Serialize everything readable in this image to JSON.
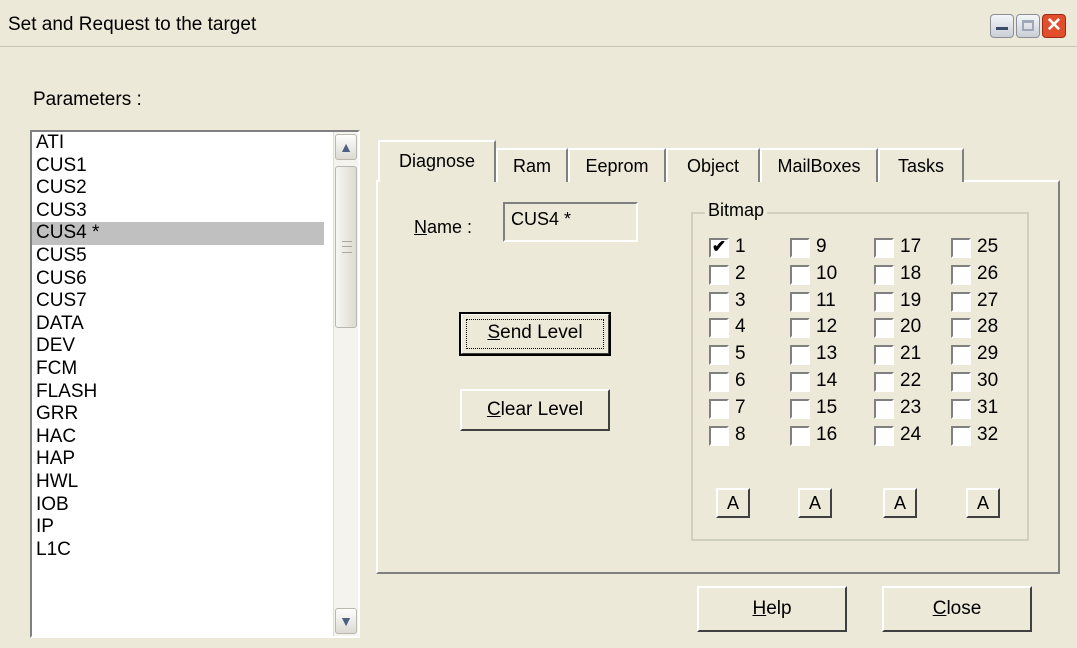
{
  "window": {
    "title": "Set and Request to the target"
  },
  "parameters_label": "Parameters :",
  "parameters_list": {
    "items": [
      "ATI",
      "CUS1",
      "CUS2",
      "CUS3",
      "CUS4 *",
      "CUS5",
      "CUS6",
      "CUS7",
      "DATA",
      "DEV",
      "FCM",
      "FLASH",
      "GRR",
      "HAC",
      "HAP",
      "HWL",
      "IOB",
      "IP",
      "L1C"
    ],
    "selected": "CUS4 *"
  },
  "tabs": [
    "Diagnose",
    "Ram",
    "Eeprom",
    "Object",
    "MailBoxes",
    "Tasks"
  ],
  "active_tab": "Diagnose",
  "name": {
    "label_underlined": "N",
    "label_rest": "ame :",
    "value": "CUS4 *"
  },
  "buttons": {
    "send_level": {
      "underlined": "S",
      "rest": "end Level"
    },
    "clear_level": {
      "underlined": "C",
      "rest": "lear Level"
    },
    "help": {
      "underlined": "H",
      "rest": "elp"
    },
    "close": {
      "underlined": "C",
      "rest": "lose"
    }
  },
  "bitmap": {
    "title": "Bitmap",
    "columns": [
      [
        "1",
        "2",
        "3",
        "4",
        "5",
        "6",
        "7",
        "8"
      ],
      [
        "9",
        "10",
        "11",
        "12",
        "13",
        "14",
        "15",
        "16"
      ],
      [
        "17",
        "18",
        "19",
        "20",
        "21",
        "22",
        "23",
        "24"
      ],
      [
        "25",
        "26",
        "27",
        "28",
        "29",
        "30",
        "31",
        "32"
      ]
    ],
    "checked": [
      "1"
    ],
    "column_buttons": [
      "A",
      "A",
      "A",
      "A"
    ]
  },
  "colors": {
    "background": "#ece9d8",
    "selection": "#c0c0c0",
    "close_button": "#e14e2c"
  }
}
